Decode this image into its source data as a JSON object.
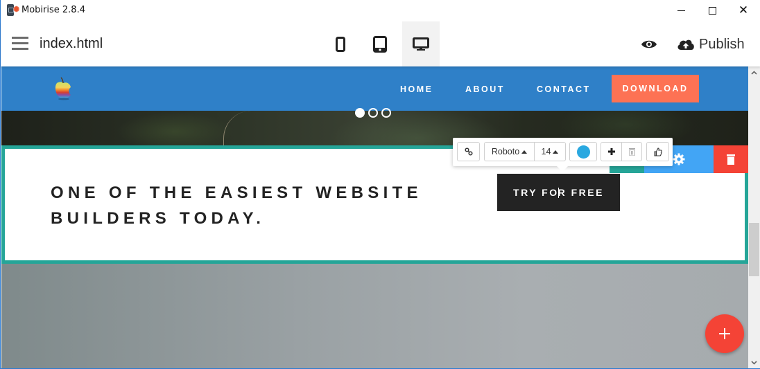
{
  "window": {
    "title": "Mobirise 2.8.4",
    "controls": {
      "minimize": "minimize-icon",
      "maximize": "maximize-icon",
      "close": "close-icon",
      "close_glyph": "✕"
    }
  },
  "toolbar": {
    "menu_icon": "hamburger-icon",
    "filename": "index.html",
    "devices": [
      {
        "name": "mobile",
        "icon": "mobile-icon",
        "active": false
      },
      {
        "name": "tablet",
        "icon": "tablet-icon",
        "active": false
      },
      {
        "name": "desktop",
        "icon": "desktop-icon",
        "active": true
      }
    ],
    "preview_icon": "eye-icon",
    "publish_icon": "cloud-upload-icon",
    "publish_label": "Publish"
  },
  "site": {
    "logo": "apple-logo",
    "nav": {
      "links": [
        "HOME",
        "ABOUT",
        "CONTACT"
      ],
      "cta": "DOWNLOAD"
    },
    "slider": {
      "total": 3,
      "active_index": 0
    },
    "block": {
      "headline_line1": "ONE OF THE EASIEST WEBSITE",
      "headline_line2": "BUILDERS TODAY.",
      "button_text_before_caret": "TRY FO",
      "button_text_after_caret": "R FREE"
    },
    "block_tools": {
      "move_icon": "move-icon",
      "settings_icon": "gear-icon",
      "delete_icon": "trash-icon"
    }
  },
  "text_toolbar": {
    "link_icon": "link-icon",
    "font": "Roboto",
    "font_size": "14",
    "color": "#29a8e0",
    "add_icon": "plus-icon",
    "remove_icon": "trash-icon",
    "like_icon": "thumbs-up-icon"
  },
  "fab": {
    "icon": "plus-icon"
  },
  "colors": {
    "nav_bg": "#2f80c8",
    "download_bg": "#fd7254",
    "block_border": "#25a598",
    "settings_bg": "#42a5f5",
    "delete_bg": "#f44336",
    "cta_bg": "#232323"
  }
}
